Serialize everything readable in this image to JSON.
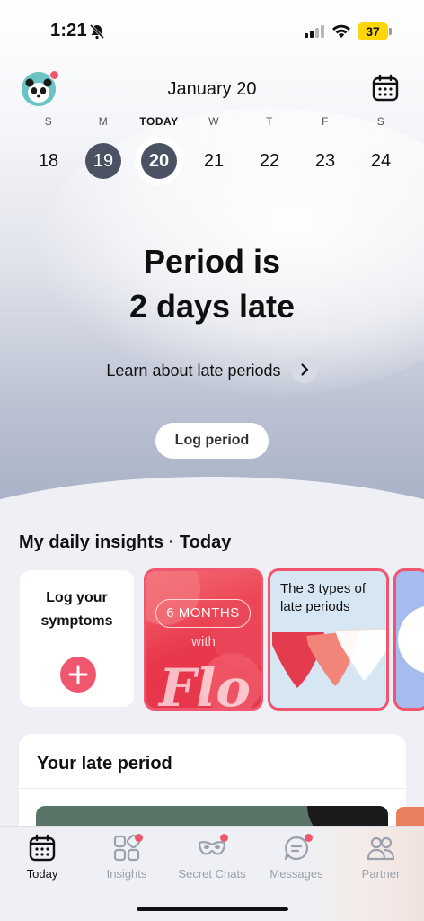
{
  "status_bar": {
    "time": "1:21",
    "battery": "37"
  },
  "header": {
    "date": "January 20"
  },
  "week": [
    {
      "letter": "S",
      "num": "18",
      "state": "normal"
    },
    {
      "letter": "M",
      "num": "19",
      "state": "past"
    },
    {
      "letter": "TODAY",
      "num": "20",
      "state": "today"
    },
    {
      "letter": "W",
      "num": "21",
      "state": "normal"
    },
    {
      "letter": "T",
      "num": "22",
      "state": "normal"
    },
    {
      "letter": "F",
      "num": "23",
      "state": "normal"
    },
    {
      "letter": "S",
      "num": "24",
      "state": "normal"
    }
  ],
  "hero": {
    "line1": "Period is",
    "line2": "2 days late",
    "learn_link": "Learn about late periods",
    "log_button": "Log period"
  },
  "insights": {
    "title": "My daily insights · Today",
    "log_card_line1": "Log your",
    "log_card_line2": "symptoms",
    "promo_pill": "6 MONTHS",
    "promo_with": "with",
    "promo_logo": "Flo",
    "types_card_title": "The 3 types of late periods"
  },
  "late_card": {
    "title": "Your late period"
  },
  "tabs": [
    {
      "label": "Today",
      "icon": "calendar-icon",
      "active": true,
      "badge": false
    },
    {
      "label": "Insights",
      "icon": "grid-diamond-icon",
      "active": false,
      "badge": true
    },
    {
      "label": "Secret Chats",
      "icon": "mask-icon",
      "active": false,
      "badge": true
    },
    {
      "label": "Messages",
      "icon": "chat-bubble-icon",
      "active": false,
      "badge": true
    },
    {
      "label": "Partner",
      "icon": "people-icon",
      "active": false,
      "badge": false
    }
  ],
  "colors": {
    "accent": "#f0566d",
    "selected_day": "#4a5264",
    "battery": "#ffd60a"
  }
}
